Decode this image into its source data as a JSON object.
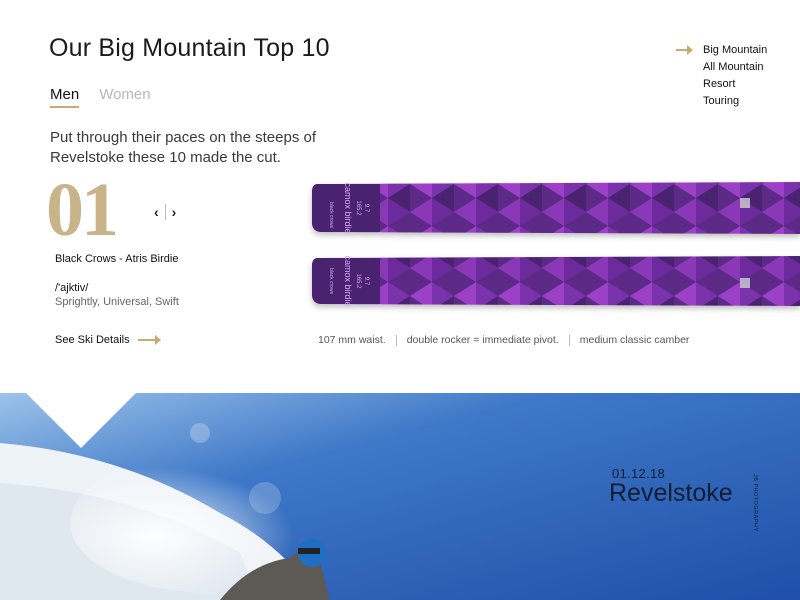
{
  "header": {
    "title": "Our Big Mountain Top 10"
  },
  "gender_tabs": [
    {
      "label": "Men",
      "active": true
    },
    {
      "label": "Women",
      "active": false
    }
  ],
  "intro": "Put through their paces on the steeps of Revelstoke these 10 made the cut.",
  "ski": {
    "rank": "01",
    "name": "Black Crows - Atris Birdie",
    "phonetic": "/'ajktiv/",
    "adjectives": "Sprightly, Universal, Swift",
    "details_label": "See Ski Details",
    "graphic": {
      "model_text": "camox birdie",
      "length": "165.2",
      "size": "9.7",
      "brand_text": "black crows",
      "base_color": "#5b2a86",
      "accent_color": "#9b3fc7"
    },
    "specs": [
      "107 mm waist.",
      "double rocker = immediate pivot.",
      "medium classic camber"
    ]
  },
  "categories": [
    {
      "label": "Big Mountain",
      "selected": true
    },
    {
      "label": "All Mountain",
      "selected": false
    },
    {
      "label": "Resort",
      "selected": false
    },
    {
      "label": "Touring",
      "selected": false
    }
  ],
  "hero": {
    "date": "01.12.18",
    "place": "Revelstoke",
    "credit": "JB PHOTOGRAPHY"
  },
  "colors": {
    "accent_gold": "#c7ab72",
    "text_dark": "#1b1b1b",
    "sky_blue": "#2f5fb3",
    "navy": "#0d1e33"
  }
}
